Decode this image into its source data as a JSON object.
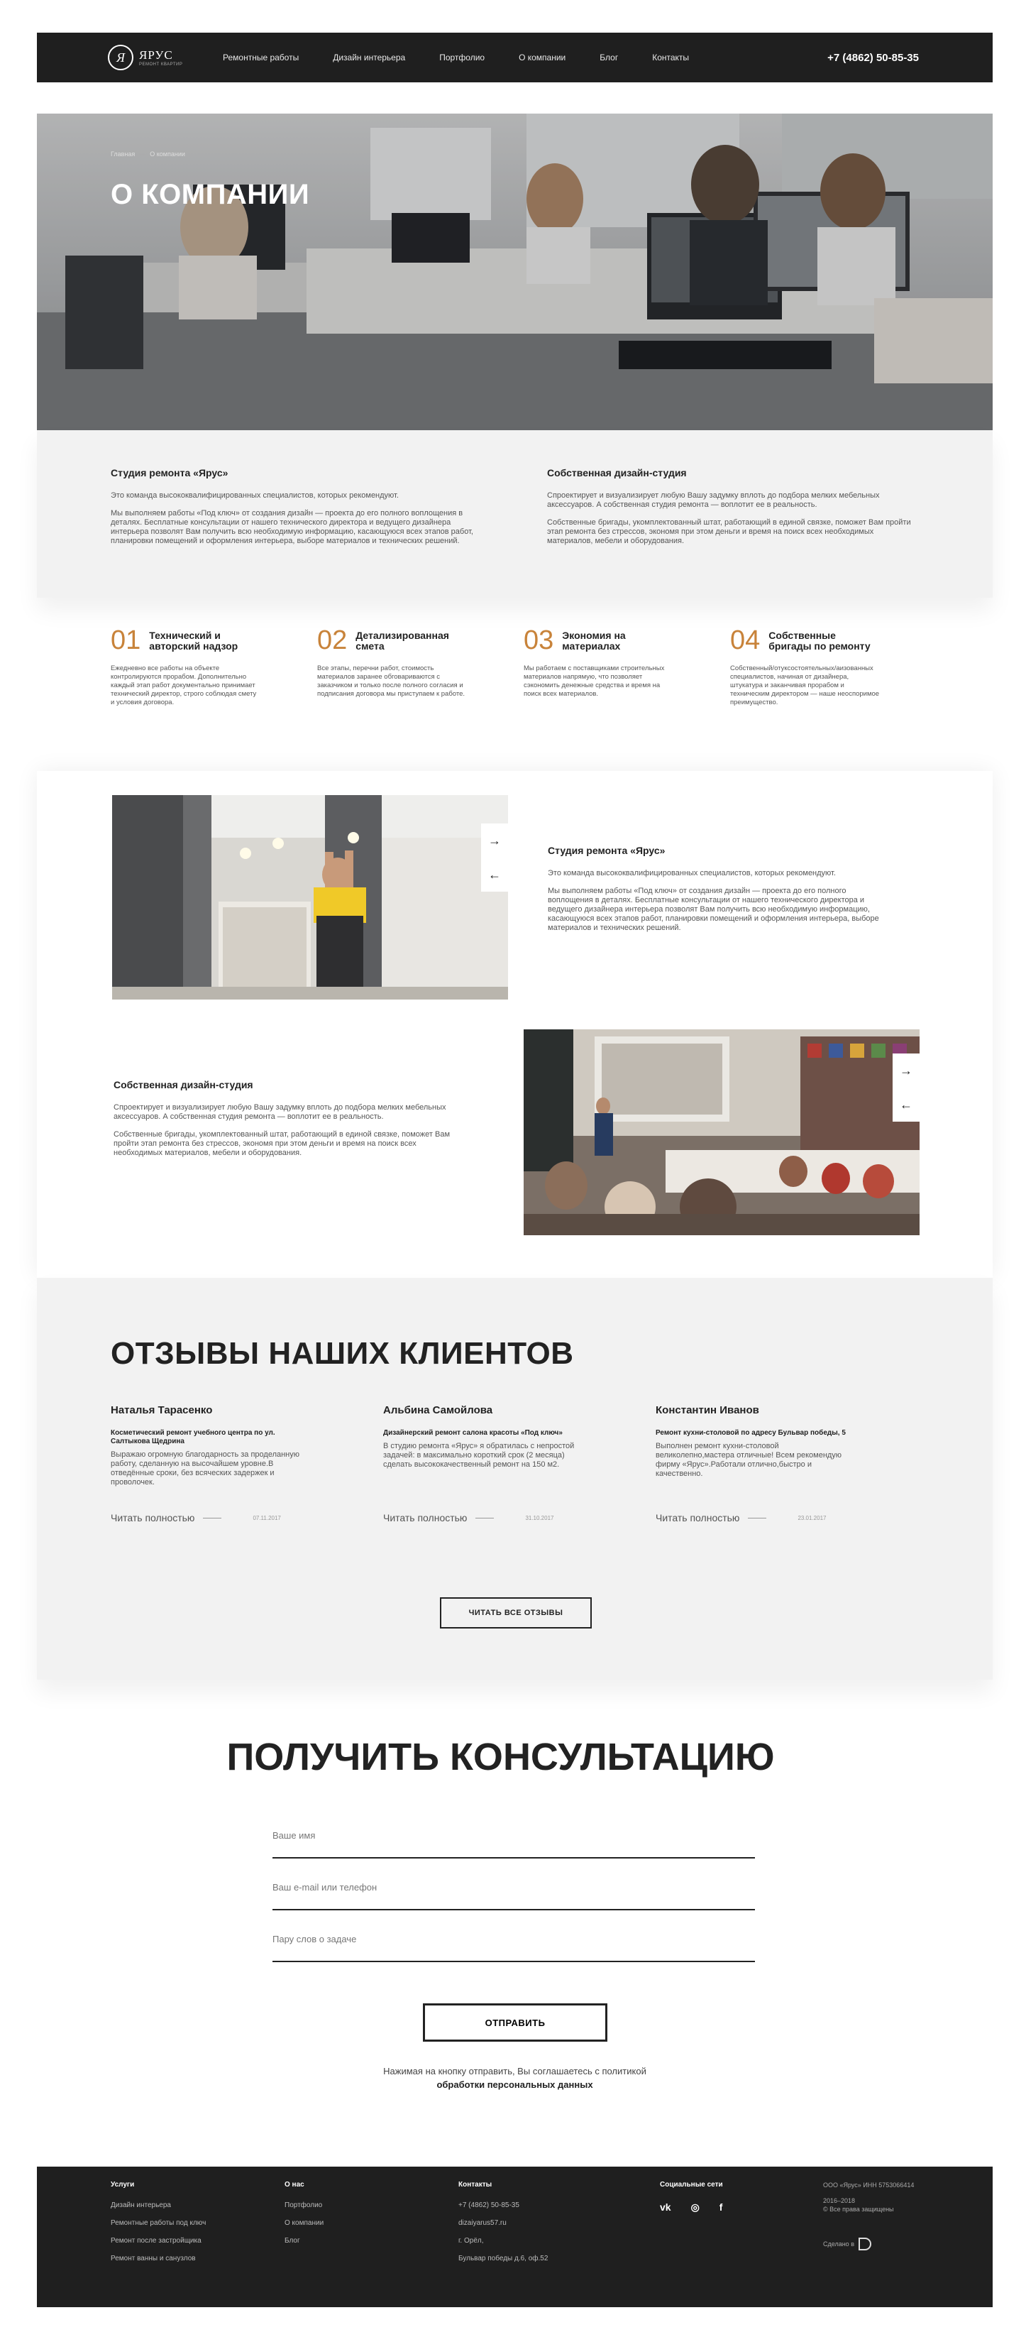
{
  "header": {
    "logo_name": "ЯРУС",
    "logo_sub": "РЕМОНТ КВАРТИР",
    "nav": [
      "Ремонтные работы",
      "Дизайн интерьера",
      "Портфолио",
      "О компании",
      "Блог",
      "Контакты"
    ],
    "phone": "+7 (4862) 50-85-35"
  },
  "hero": {
    "breadcrumbs": [
      "Главная",
      "О компании"
    ],
    "title": "О КОМПАНИИ"
  },
  "intro": {
    "left": {
      "title": "Студия ремонта «Ярус»",
      "p1": "Это команда высококвалифицированных специалистов, которых рекомендуют.",
      "p2": "Мы выполняем работы «Под ключ» от создания дизайн — проекта до его полного воплощения в деталях. Бесплатные консультации от нашего технического директора и ведущего дизайнера интерьера позволят Вам получить всю необходимую информацию, касающуюся всех этапов работ, планировки помещений и оформления интерьера, выборе материалов и технических решений."
    },
    "right": {
      "title": "Собственная дизайн-студия",
      "p1": "Спроектирует и визуализирует любую Вашу задумку вплоть до подбора мелких мебельных аксессуаров. А собственная студия ремонта — воплотит ее в реальность.",
      "p2": "Собственные бригады, укомплектованный штат, работающий в единой связке, поможет Вам пройти этап ремонта без стрессов, экономя при этом деньги и время на поиск всех необходимых материалов, мебели и оборудования."
    }
  },
  "features": [
    {
      "num": "01",
      "title": "Технический и авторский надзор",
      "text": "Ежедневно все работы на объекте контролируются прорабом. Дополнительно каждый этап работ документально принимает технический директор, строго соблюдая смету и условия договора."
    },
    {
      "num": "02",
      "title": "Детализированная смета",
      "text": "Все этапы, перечни работ, стоимость материалов заранее обговариваются с заказчиком и только после полного согласия и подписания договора мы приступаем к работе."
    },
    {
      "num": "03",
      "title": "Экономия на материалах",
      "text": "Мы работаем с поставщиками строительных материалов напрямую, что позволяет сэкономить денежные средства и время на поиск всех материалов."
    },
    {
      "num": "04",
      "title": "Собственные бригады по ремонту",
      "text": "Собственный/отуксостоятельных/аизованных специалистов, начиная от дизайнера, штукатура и заканчивая прорабом и техническим директором — наше неоспоримое преимущество."
    }
  ],
  "studio": {
    "block1": {
      "title": "Студия ремонта «Ярус»",
      "p1": "Это команда высококвалифицированных специалистов, которых рекомендуют.",
      "p2": "Мы выполняем работы «Под ключ» от создания дизайн — проекта до его полного воплощения в деталях. Бесплатные консультации от нашего технического директора и ведущего дизайнера интерьера позволят Вам получить всю необходимую информацию, касающуюся всех этапов работ, планировки помещений и оформления интерьера, выборе материалов и технических решений."
    },
    "block2": {
      "title": "Собственная дизайн-студия",
      "p1": "Спроектирует и визуализирует любую Вашу задумку вплоть до подбора мелких мебельных аксессуаров. А собственная студия ремонта — воплотит ее в реальность.",
      "p2": "Собственные бригады, укомплектованный штат, работающий в единой связке, поможет Вам пройти этап ремонта без стрессов, экономя при этом деньги и время на поиск всех необходимых материалов, мебели и оборудования."
    },
    "arrow_next": "→",
    "arrow_prev": "←"
  },
  "reviews": {
    "title": "ОТЗЫВЫ НАШИХ КЛИЕНТОВ",
    "items": [
      {
        "name": "Наталья Тарасенко",
        "subject": "Косметический ремонт учебного центра по ул. Салтыкова Щедрина",
        "text": "Выражаю огромную благодарность за проделанную работу, сделанную на высочайшем уровне.В отведённые сроки, без всяческих задержек и проволочек.",
        "read": "Читать полностью",
        "date": "07.11.2017"
      },
      {
        "name": "Альбина Самойлова",
        "subject": "Дизайнерский ремонт салона красоты «Под ключ»",
        "text": "В студию ремонта «Ярус» я обратилась с непростой задачей: в максимально короткий срок (2 месяца) сделать высококачественный ремонт на 150 м2.",
        "read": "Читать полностью",
        "date": "31.10.2017"
      },
      {
        "name": "Константин Иванов",
        "subject": "Ремонт кухни-столовой по адресу Бульвар победы, 5",
        "text": "Выполнен ремонт кухни-столовой великолепно,мастера отличные! Всем рекомендую фирму «Ярус».Работали отлично,быстро и качественно.",
        "read": "Читать полностью",
        "date": "23.01.2017"
      }
    ],
    "all_button": "ЧИТАТЬ ВСЕ ОТЗЫВЫ"
  },
  "consult": {
    "title": "ПОЛУЧИТЬ КОНСУЛЬТАЦИЮ",
    "name_placeholder": "Ваше имя",
    "contact_placeholder": "Ваш e-mail или телефон",
    "task_placeholder": "Пару слов о задаче",
    "submit": "ОТПРАВИТЬ",
    "agree_text": "Нажимая на кнопку отправить, Вы соглашаетесь с политикой",
    "agree_link": "обработки персональных данных"
  },
  "footer": {
    "services_title": "Услуги",
    "services": [
      "Дизайн интерьера",
      "Ремонтные работы под ключ",
      "Ремонт после застройщика",
      "Ремонт ванны и санузлов"
    ],
    "about_title": "О нас",
    "about": [
      "Портфолио",
      "О компании",
      "Блог"
    ],
    "contacts_title": "Контакты",
    "contacts": [
      "+7 (4862) 50-85-35",
      "dizaiyarus57.ru",
      "г. Орёл,",
      "Бульвар победы д.6, оф.52"
    ],
    "social_title": "Социальные сети",
    "social": [
      "vk",
      "◎",
      "f"
    ],
    "org": "ООО «Ярус» ИНН 5753066414",
    "years": "2016–2018",
    "rights": "© Все права защищены",
    "made_by": "Сделано в"
  },
  "colors": {
    "accent": "#c8833a",
    "dark": "#1f1f1f",
    "light_bg": "#f2f2f2"
  }
}
